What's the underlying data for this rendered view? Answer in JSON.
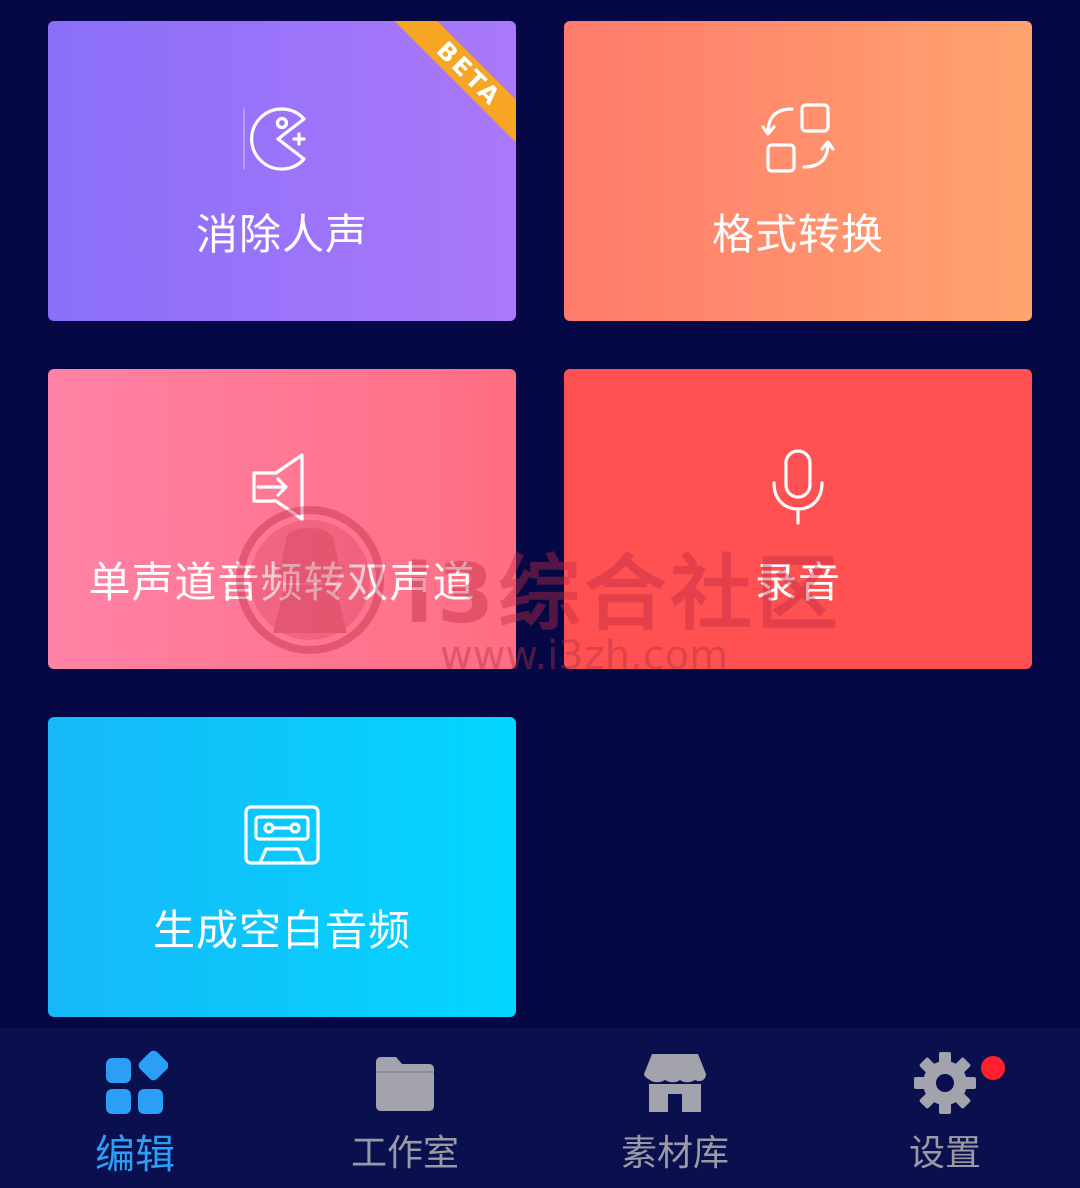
{
  "cards": [
    {
      "label": "消除人声",
      "icon": "vocal-remove-icon",
      "badge": "BETA",
      "gradient": [
        "#8a6ff8",
        "#aa78fb"
      ]
    },
    {
      "label": "格式转换",
      "icon": "format-convert-icon",
      "gradient": [
        "#ff7a6c",
        "#ffa46e"
      ]
    },
    {
      "label": "单声道音频转双声道",
      "icon": "speaker-icon",
      "gradient": [
        "#ff82a6",
        "#ff6e82"
      ]
    },
    {
      "label": "录音",
      "icon": "microphone-icon",
      "gradient": [
        "#ff5151",
        "#ff5151"
      ]
    },
    {
      "label": "生成空白音频",
      "icon": "cassette-icon",
      "gradient": [
        "#17b8f8",
        "#02d6ff"
      ]
    }
  ],
  "watermark": {
    "title": "i3综合社区",
    "url": "www.i3zh.com"
  },
  "tabbar": {
    "active_color": "#2a9ff5",
    "inactive_color": "#9a9aa6",
    "tabs": [
      {
        "label": "编辑",
        "icon": "grid-icon",
        "active": true
      },
      {
        "label": "工作室",
        "icon": "folder-icon",
        "active": false
      },
      {
        "label": "素材库",
        "icon": "store-icon",
        "active": false
      },
      {
        "label": "设置",
        "icon": "gear-icon",
        "active": false,
        "notification_dot": true
      }
    ]
  },
  "colors": {
    "background": "#050845",
    "tabbar_background": "#0a104e",
    "badge": "#f7a623",
    "notification_dot": "#ff1f2d"
  }
}
